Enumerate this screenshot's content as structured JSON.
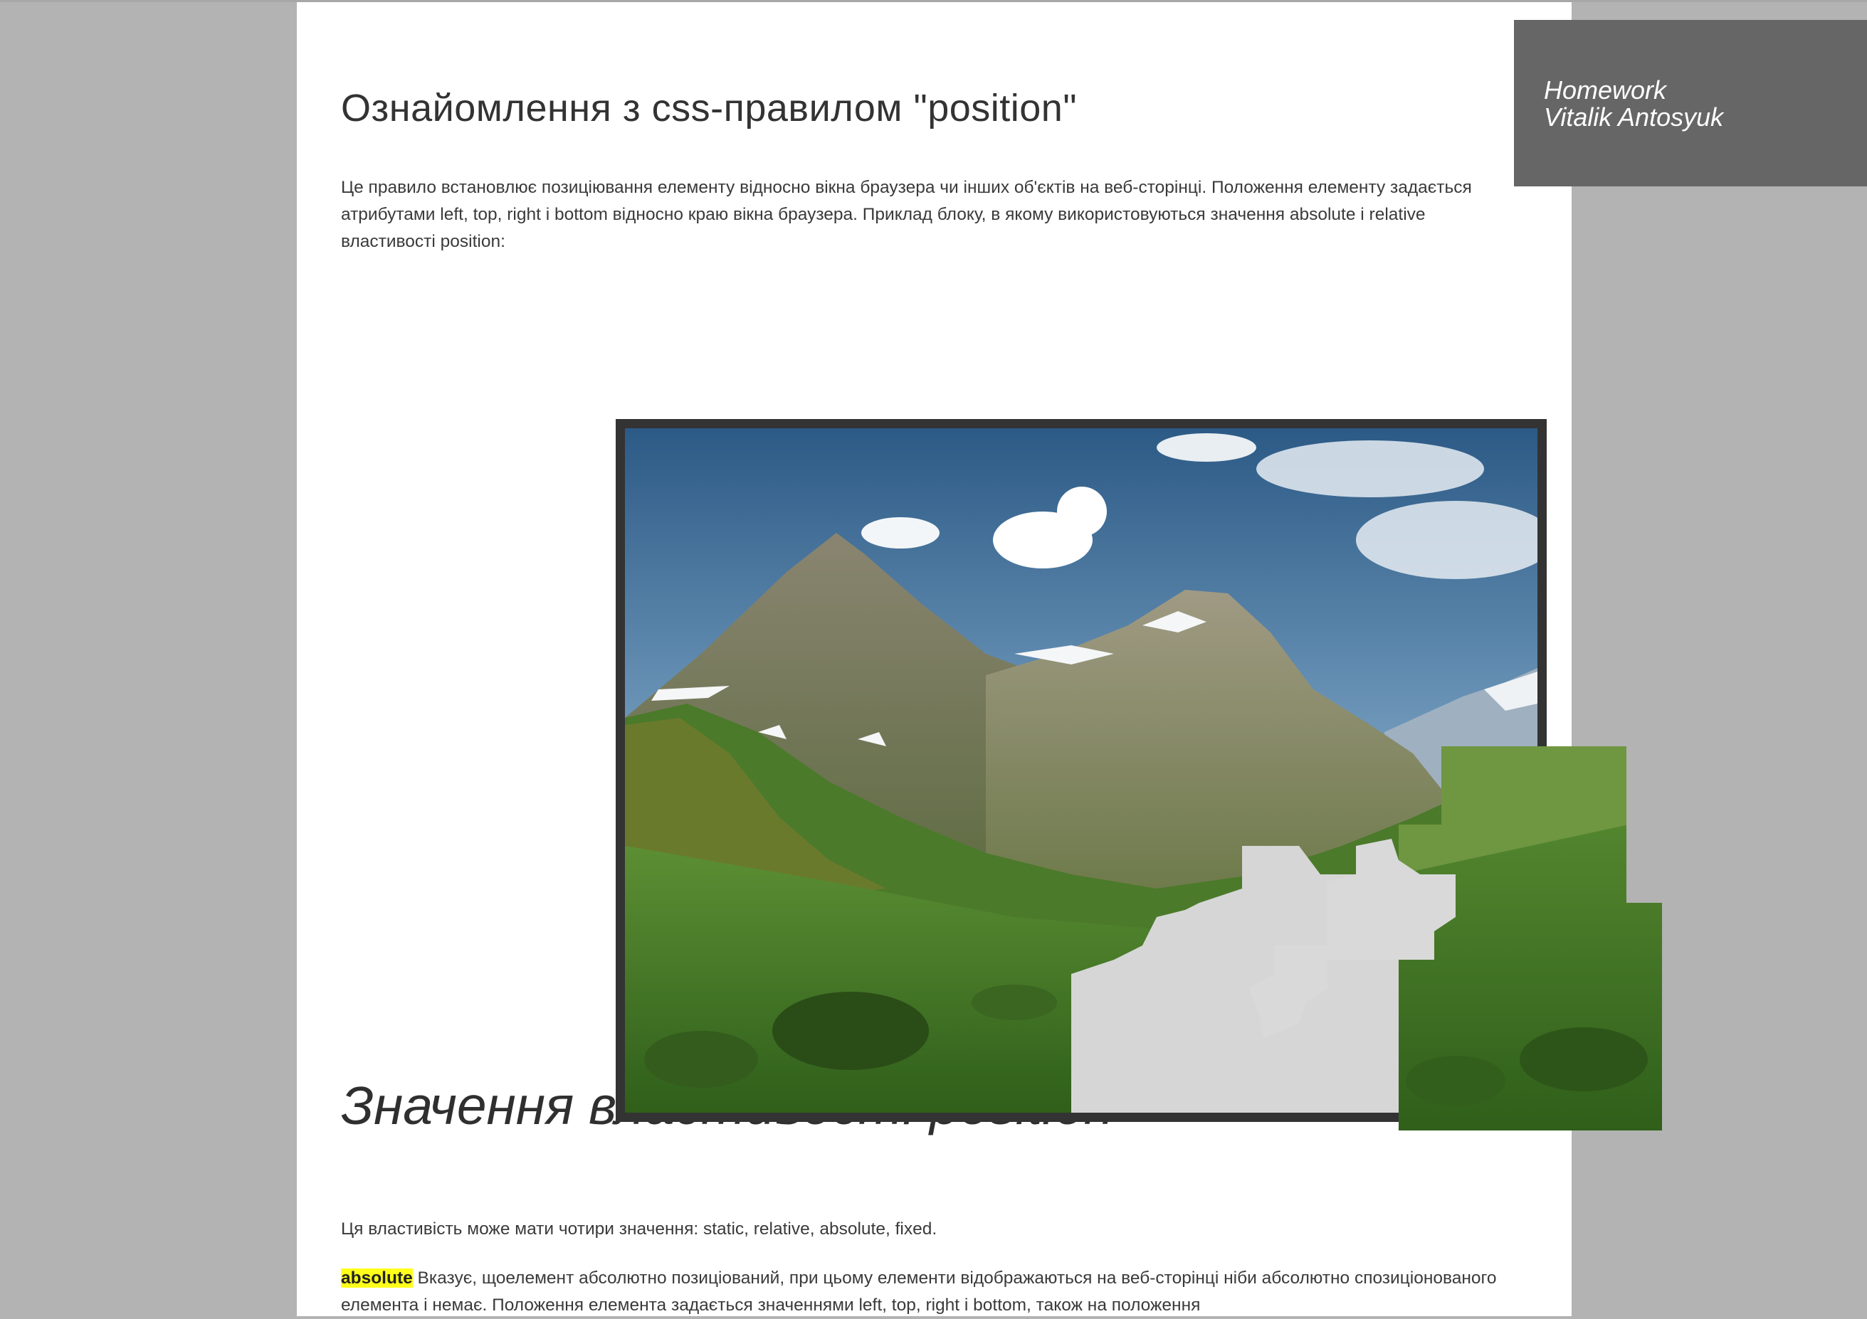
{
  "header": {
    "title": "Ознайомлення з css-правилом \"position\"",
    "intro": "Це правило встановлює позиціювання елементу відносно вікна браузера чи інших об'єктів на веб-сторінці. Положення елементу задається атрибутами left, top, right і bottom відносно краю вікна браузера. Приклад блоку, в якому використовуються значення absolute і relative властивості position:"
  },
  "badge": {
    "line1": "Homework",
    "line2": "Vitalik Antosyuk"
  },
  "section": {
    "heading": "Значення властивості position",
    "values_text": "Ця властивість може мати чотири значення: static, relative, absolute, fixed.",
    "absolute_term": "absolute",
    "absolute_desc": " Вказує, щоелемент абсолютно позиціований, при цьому елементи відображаються на веб-сторінці ніби абсолютно спозиціонованого елемента і немає. Положення елемента задається значеннями left, top, right і bottom, також на положення"
  },
  "image": {
    "subject": "mountain-landscape-puzzle",
    "colors": {
      "frame": "#333333",
      "sky_top": "#2c5a86",
      "sky_bottom": "#c9dbe9",
      "grass": "#3f7a22",
      "empty_slot": "#d6d6d6"
    }
  },
  "colors": {
    "background": "#b3b3b3",
    "page": "#ffffff",
    "badge": "#666666",
    "highlight": "#ffff1a"
  }
}
